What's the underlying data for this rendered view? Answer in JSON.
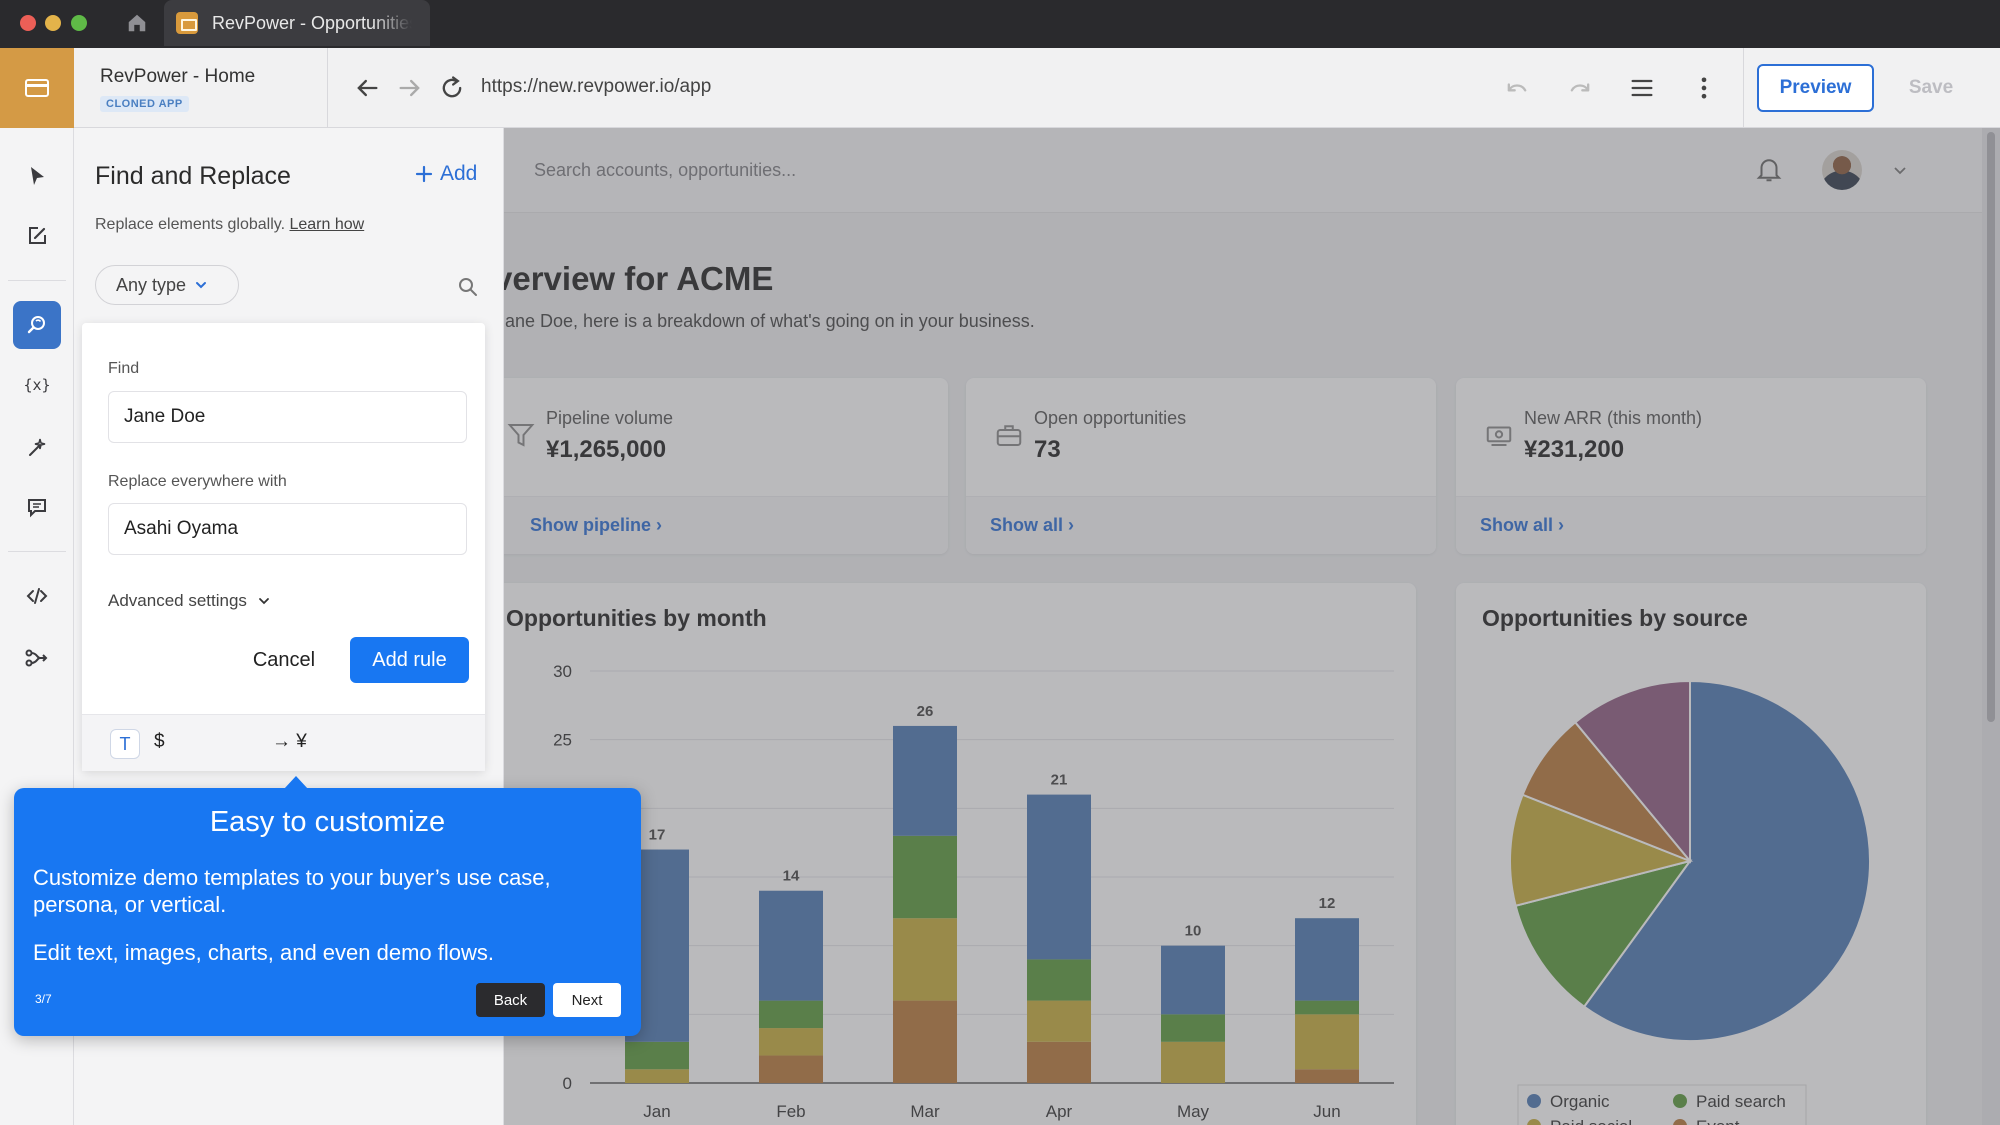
{
  "browser": {
    "tab_title": "RevPower - Opportunities"
  },
  "editor": {
    "app_name": "RevPower - Home",
    "app_badge": "CLONED APP",
    "url": "https://new.revpower.io/app",
    "preview_label": "Preview",
    "save_label": "Save"
  },
  "rail": {
    "icons": [
      "cursor-icon",
      "edit-icon",
      "find-replace-icon",
      "variables-icon",
      "magic-icon",
      "comment-icon",
      "code-icon",
      "flow-icon"
    ],
    "active": "find-replace-icon"
  },
  "panel": {
    "title": "Find and Replace",
    "add_label": "Add",
    "subtitle": "Replace elements globally.",
    "learn_link": "Learn how",
    "filter_value": "Any type",
    "find_label": "Find",
    "find_value": "Jane Doe",
    "replace_label": "Replace everywhere with",
    "replace_value": "Asahi Oyama",
    "advanced_label": "Advanced settings",
    "cancel_label": "Cancel",
    "add_rule_label": "Add rule",
    "rule": {
      "type_badge": "T",
      "from": "$",
      "to": "→ ¥"
    }
  },
  "app": {
    "search_placeholder": "Search accounts, opportunities...",
    "overview_title": "verview for ACME",
    "overview_sub": "Jane Doe, here is a breakdown of what's going on in your business.",
    "stats": [
      {
        "label": "Pipeline volume",
        "value": "¥1,265,000",
        "link": "Show pipeline ›",
        "icon": "funnel-icon"
      },
      {
        "label": "Open opportunities",
        "value": "73",
        "link": "Show all ›",
        "icon": "briefcase-icon"
      },
      {
        "label": "New ARR (this month)",
        "value": "¥231,200",
        "link": "Show all ›",
        "icon": "cash-icon"
      }
    ],
    "bar_chart_title": "Opportunities by month",
    "pie_chart_title": "Opportunities by source"
  },
  "tour": {
    "title": "Easy to customize",
    "body1": "Customize demo templates to your buyer’s use case, persona, or vertical.",
    "body2": "Edit text, images, charts, and even demo flows.",
    "step": "3/7",
    "back_label": "Back",
    "next_label": "Next"
  },
  "colors": {
    "organic": "#4d79b4",
    "paid_search": "#5a9a3c",
    "paid_social": "#c7ad3c",
    "event": "#b8793a",
    "other": "#8f5c82",
    "accent": "#1877f2"
  },
  "chart_data": [
    {
      "type": "bar",
      "title": "Opportunities by month",
      "stacked": true,
      "categories": [
        "Jan",
        "Feb",
        "Mar",
        "Apr",
        "May",
        "Jun"
      ],
      "totals": [
        17,
        14,
        26,
        21,
        10,
        12
      ],
      "ylim": [
        0,
        30
      ],
      "yticks": [
        0,
        25,
        30
      ],
      "series": [
        {
          "name": "Event",
          "color": "#b8793a",
          "values": [
            0,
            2,
            6,
            3,
            0,
            1
          ]
        },
        {
          "name": "Paid social",
          "color": "#c7ad3c",
          "values": [
            1,
            2,
            6,
            3,
            3,
            4
          ]
        },
        {
          "name": "Paid search",
          "color": "#5a9a3c",
          "values": [
            2,
            2,
            6,
            3,
            2,
            1
          ]
        },
        {
          "name": "Organic",
          "color": "#4d79b4",
          "values": [
            14,
            8,
            8,
            12,
            5,
            6
          ]
        }
      ]
    },
    {
      "type": "pie",
      "title": "Opportunities by source",
      "slices": [
        {
          "name": "Organic",
          "value": 60,
          "color": "#4d79b4"
        },
        {
          "name": "Paid search",
          "value": 11,
          "color": "#5a9a3c"
        },
        {
          "name": "Paid social",
          "value": 10,
          "color": "#c7ad3c"
        },
        {
          "name": "Event",
          "value": 8,
          "color": "#b8793a"
        },
        {
          "name": "",
          "value": 11,
          "color": "#8f5c82"
        }
      ],
      "legend": [
        "Organic",
        "Paid search",
        "Paid social",
        "Event"
      ]
    }
  ]
}
